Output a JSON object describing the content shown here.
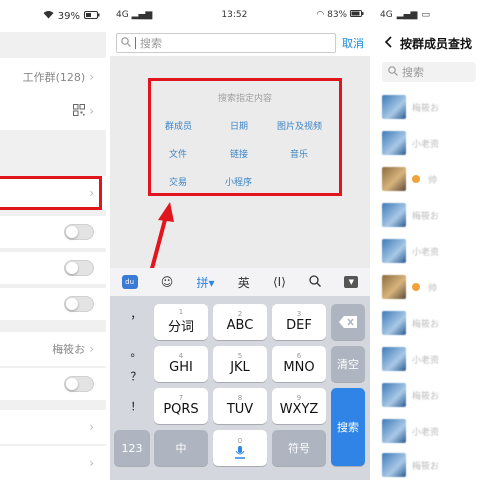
{
  "left_panel": {
    "status": {
      "wifi": "wifi-icon",
      "battery_pct": "39%"
    },
    "rows": [
      {
        "text": "工作群(128)",
        "chevron": "›"
      },
      {
        "icon": "qr-code-icon",
        "chevron": "›"
      },
      {
        "chevron": "›"
      }
    ],
    "member_alias": "梅筱お",
    "chevron": "›"
  },
  "middle_panel": {
    "status": {
      "network": "4G",
      "time": "13:52",
      "battery_pct": "83%"
    },
    "search": {
      "placeholder": "搜索",
      "cancel_label": "取消"
    },
    "search_menu": {
      "title": "搜索指定内容",
      "items": [
        "群成员",
        "日期",
        "图片及视频",
        "文件",
        "链接",
        "音乐",
        "交易",
        "小程序"
      ]
    },
    "keyboard": {
      "toolbar": {
        "pinyin_label": "拼",
        "english_label": "英",
        "cursor_label": "I"
      },
      "punctuation": [
        "，",
        "。",
        "？",
        "！"
      ],
      "keys": [
        {
          "num": "1",
          "label": "分词"
        },
        {
          "num": "2",
          "label": "ABC"
        },
        {
          "num": "3",
          "label": "DEF"
        },
        {
          "num": "4",
          "label": "GHI"
        },
        {
          "num": "5",
          "label": "JKL"
        },
        {
          "num": "6",
          "label": "MNO"
        },
        {
          "num": "7",
          "label": "PQRS"
        },
        {
          "num": "8",
          "label": "TUV"
        },
        {
          "num": "9",
          "label": "WXYZ"
        }
      ],
      "clear_label": "清空",
      "search_label": "搜索",
      "num_label": "123",
      "lang_label": "中",
      "symbol_label": "符号",
      "zero_num": "0"
    }
  },
  "right_panel": {
    "status": {
      "network": "4G"
    },
    "title": "按群成员查找",
    "search_placeholder": "搜索",
    "members": [
      {
        "name": "梅筱お"
      },
      {
        "name": "小老资"
      },
      {
        "name": "帅"
      },
      {
        "name": "梅筱お"
      },
      {
        "name": "小老资"
      },
      {
        "name": "帅"
      },
      {
        "name": "梅筱お"
      },
      {
        "name": "小老资"
      },
      {
        "name": "梅筱お"
      },
      {
        "name": "小老资"
      },
      {
        "name": "梅筱お"
      }
    ]
  },
  "colors": {
    "accent": "#2f84e6",
    "highlight": "#e0151d",
    "menu_text": "#3c84c4"
  }
}
